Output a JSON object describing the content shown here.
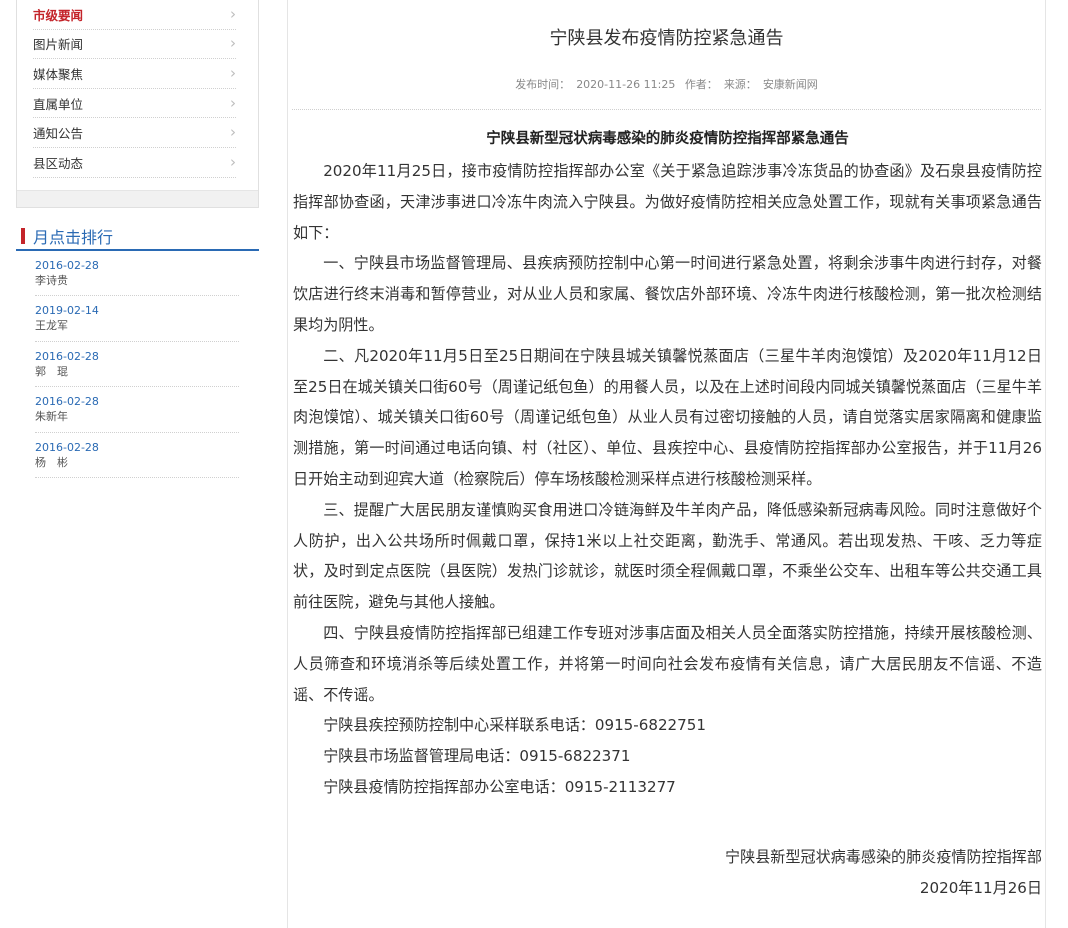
{
  "sidebar": {
    "nav_items": [
      {
        "label": "市级要闻",
        "active": true
      },
      {
        "label": "图片新闻",
        "active": false
      },
      {
        "label": "媒体聚焦",
        "active": false
      },
      {
        "label": "直属单位",
        "active": false
      },
      {
        "label": "通知公告",
        "active": false
      },
      {
        "label": "县区动态",
        "active": false
      }
    ],
    "ranking_title": "月点击排行",
    "ranking_items": [
      {
        "date": "2016-02-28",
        "name": "李诗贵"
      },
      {
        "date": "2019-02-14",
        "name": "王龙军"
      },
      {
        "date": "2016-02-28",
        "name": "郭　琨"
      },
      {
        "date": "2016-02-28",
        "name": "朱新年"
      },
      {
        "date": "2016-02-28",
        "name": "杨　彬"
      }
    ]
  },
  "article": {
    "title": "宁陕县发布疫情防控紧急通告",
    "meta": {
      "publish_label": "发布时间：",
      "publish_time": "2020-11-26 11:25",
      "author_label": "作者：",
      "source_label": "来源：",
      "source": "安康新闻网"
    },
    "heading": "宁陕县新型冠状病毒感染的肺炎疫情防控指挥部紧急通告",
    "paragraphs": [
      "2020年11月25日，接市疫情防控指挥部办公室《关于紧急追踪涉事冷冻货品的协查函》及石泉县疫情防控指挥部协查函，天津涉事进口冷冻牛肉流入宁陕县。为做好疫情防控相关应急处置工作，现就有关事项紧急通告如下：",
      "一、宁陕县市场监督管理局、县疾病预防控制中心第一时间进行紧急处置，将剩余涉事牛肉进行封存，对餐饮店进行终末消毒和暂停营业，对从业人员和家属、餐饮店外部环境、冷冻牛肉进行核酸检测，第一批次检测结果均为阴性。",
      "二、凡2020年11月5日至25日期间在宁陕县城关镇馨悦蒸面店（三星牛羊肉泡馍馆）及2020年11月12日至25日在城关镇关口街60号（周谨记纸包鱼）的用餐人员，以及在上述时间段内同城关镇馨悦蒸面店（三星牛羊肉泡馍馆）、城关镇关口街60号（周谨记纸包鱼）从业人员有过密切接触的人员，请自觉落实居家隔离和健康监测措施，第一时间通过电话向镇、村（社区）、单位、县疾控中心、县疫情防控指挥部办公室报告，并于11月26日开始主动到迎宾大道（检察院后）停车场核酸检测采样点进行核酸检测采样。",
      "三、提醒广大居民朋友谨慎购买食用进口冷链海鲜及牛羊肉产品，降低感染新冠病毒风险。同时注意做好个人防护，出入公共场所时佩戴口罩，保持1米以上社交距离，勤洗手、常通风。若出现发热、干咳、乏力等症状，及时到定点医院（县医院）发热门诊就诊，就医时须全程佩戴口罩，不乘坐公交车、出租车等公共交通工具前往医院，避免与其他人接触。",
      "四、宁陕县疫情防控指挥部已组建工作专班对涉事店面及相关人员全面落实防控措施，持续开展核酸检测、人员筛查和环境消杀等后续处置工作，并将第一时间向社会发布疫情有关信息，请广大居民朋友不信谣、不造谣、不传谣。"
    ],
    "contacts": [
      "宁陕县疾控预防控制中心采样联系电话：0915-6822751",
      "宁陕县市场监督管理局电话：0915-6822371",
      "宁陕县疫情防控指挥部办公室电话：0915-2113277"
    ],
    "signature_org": "宁陕县新型冠状病毒感染的肺炎疫情防控指挥部",
    "signature_date": "2020年11月26日"
  },
  "colors": {
    "accent_red": "#c4242a",
    "link_blue": "#2a6ab4"
  }
}
